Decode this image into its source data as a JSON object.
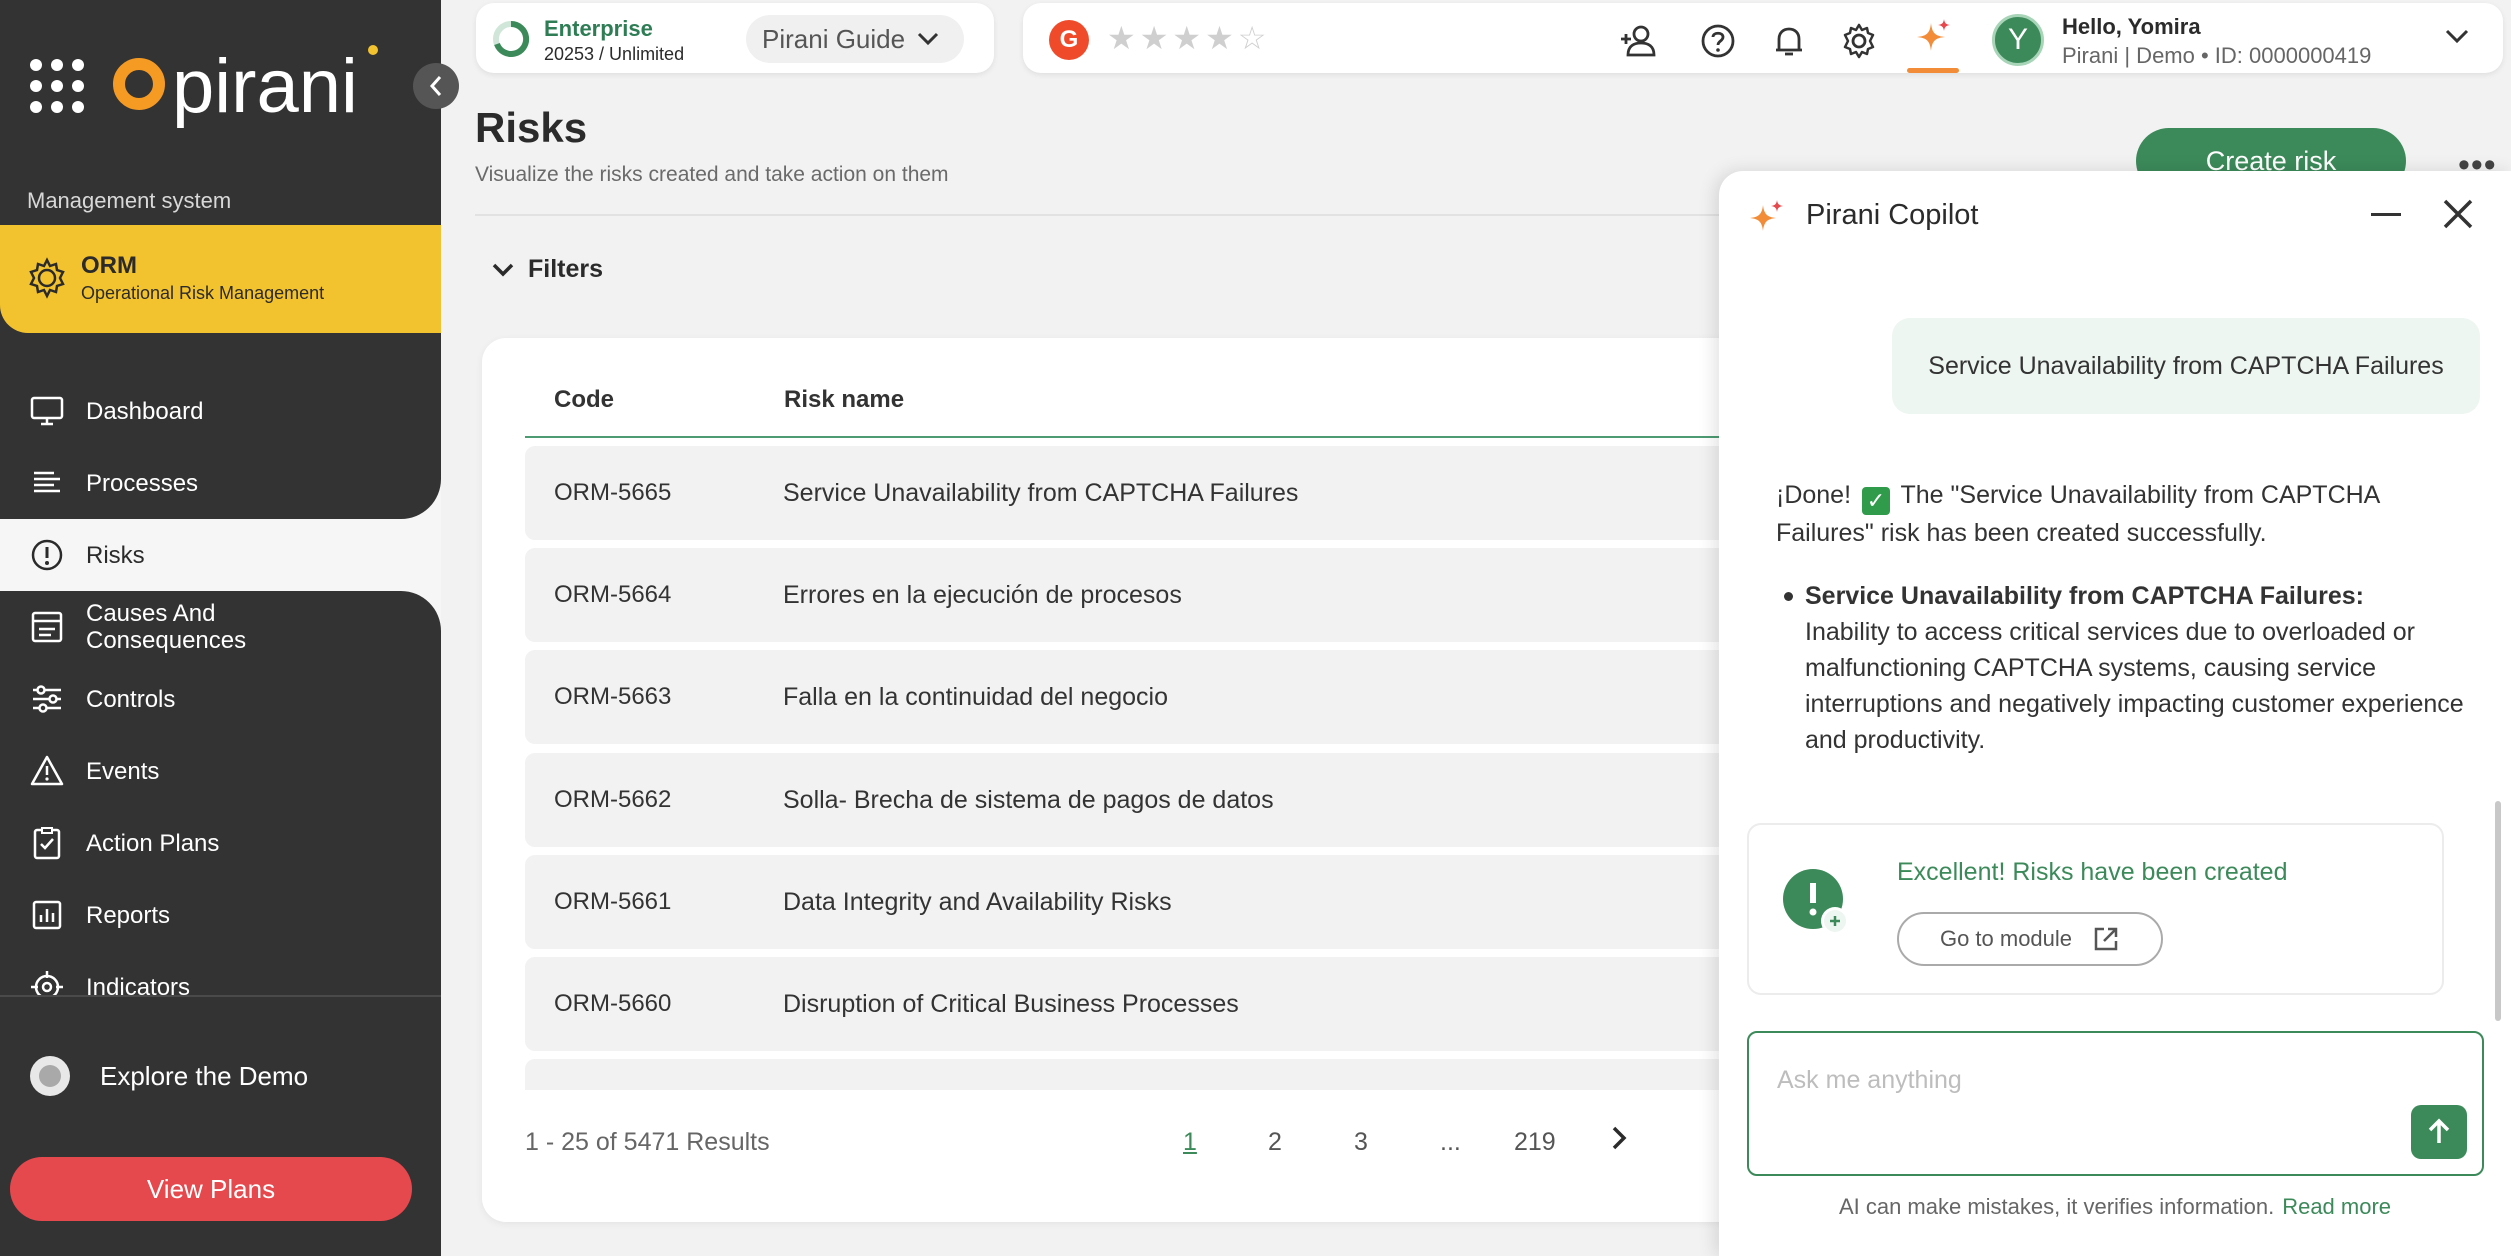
{
  "brand": {
    "name": "pirani"
  },
  "sidebar": {
    "section_label": "Management system",
    "module": {
      "name": "ORM",
      "subtitle": "Operational Risk Management"
    },
    "items": [
      {
        "label": "Dashboard",
        "icon": "monitor-icon"
      },
      {
        "label": "Processes",
        "icon": "list-icon"
      },
      {
        "label": "Risks",
        "icon": "alert-circle-icon",
        "active": true
      },
      {
        "label": "Causes And\nConsequences",
        "icon": "causes-icon"
      },
      {
        "label": "Controls",
        "icon": "sliders-icon"
      },
      {
        "label": "Events",
        "icon": "warning-icon"
      },
      {
        "label": "Action Plans",
        "icon": "clipboard-check-icon"
      },
      {
        "label": "Reports",
        "icon": "bar-chart-icon"
      },
      {
        "label": "Indicators",
        "icon": "target-icon"
      }
    ],
    "explore": "Explore the Demo",
    "view_plans": "View Plans"
  },
  "topbar": {
    "plan_name": "Enterprise",
    "plan_count": "20253 / Unlimited",
    "guide": "Pirani Guide",
    "rating_stars": 5,
    "greeting": "Hello, Yomira",
    "user_sub": "Pirani | Demo • ID: 0000000419",
    "avatar_initial": "Y"
  },
  "page": {
    "title": "Risks",
    "subtitle": "Visualize the risks created and take action on them",
    "create_button": "Create risk",
    "more": "•••",
    "filters": "Filters"
  },
  "table": {
    "headers": {
      "code": "Code",
      "name": "Risk name"
    },
    "rows": [
      {
        "code": "ORM-5665",
        "name": "Service Unavailability from CAPTCHA Failures"
      },
      {
        "code": "ORM-5664",
        "name": "Errores en la ejecución de procesos"
      },
      {
        "code": "ORM-5663",
        "name": "Falla en la continuidad del negocio"
      },
      {
        "code": "ORM-5662",
        "name": "Solla- Brecha de sistema de pagos de datos"
      },
      {
        "code": "ORM-5661",
        "name": "Data Integrity and Availability Risks"
      },
      {
        "code": "ORM-5660",
        "name": "Disruption of Critical Business Processes"
      }
    ],
    "results": "1 - 25 of 5471 Results",
    "pages": [
      "1",
      "2",
      "3",
      "...",
      "219"
    ]
  },
  "copilot": {
    "title": "Pirani Copilot",
    "user_message": "Service Unavailability from CAPTCHA Failures",
    "bot_intro_1": "¡Done!",
    "bot_intro_2": "The \"Service Unavailability from CAPTCHA Failures\" risk has been created successfully.",
    "bullet_title": "Service Unavailability from CAPTCHA Failures:",
    "bullet_text": "Inability to access critical services due to overloaded or malfunctioning CAPTCHA systems, causing service interruptions and negatively impacting customer experience and productivity.",
    "success_text": "Excellent! Risks have been created",
    "go_to_module": "Go to module",
    "input_placeholder": "Ask me anything",
    "disclaimer": "AI can make mistakes, it verifies information.",
    "read_more": "Read more"
  },
  "colors": {
    "sidebar_bg": "#333333",
    "module_yellow": "#f3c32f",
    "primary_green": "#3c8a5a",
    "danger_red": "#e5484d",
    "accent_orange": "#f28c38"
  }
}
